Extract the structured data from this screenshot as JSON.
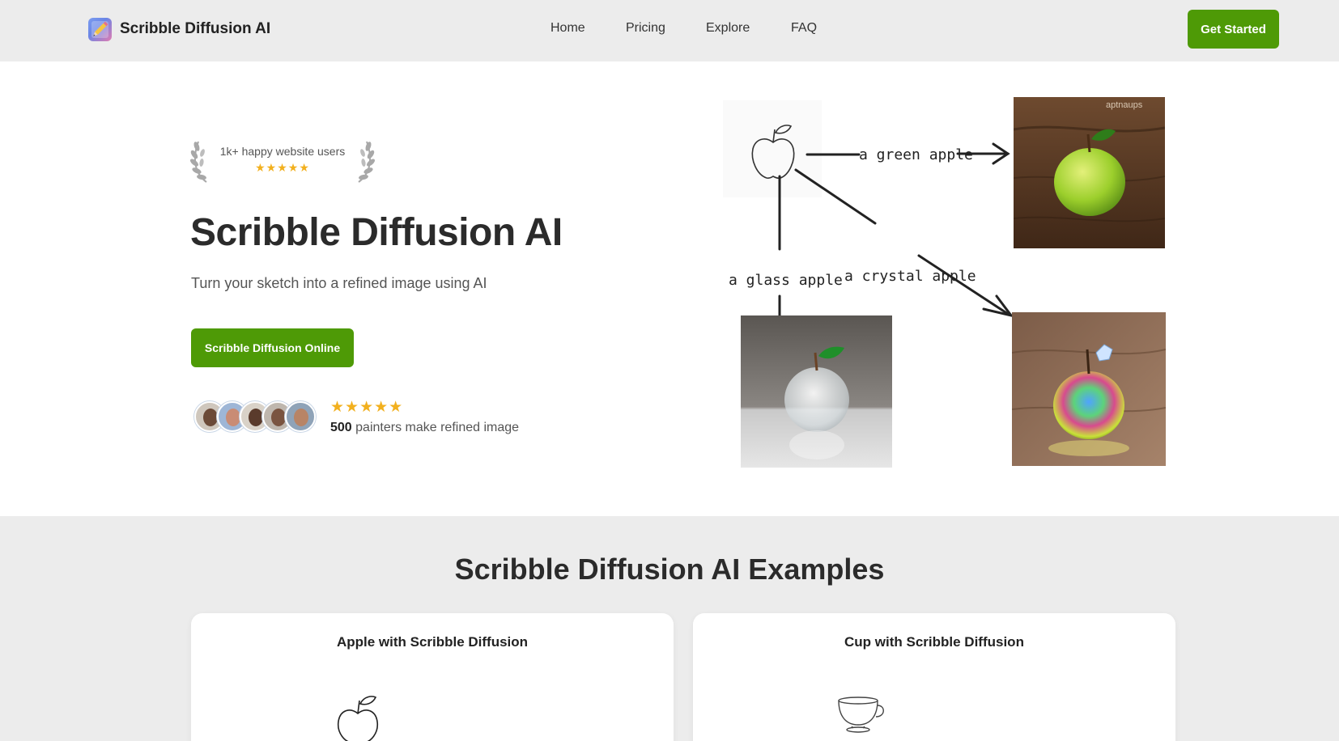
{
  "header": {
    "brand": "Scribble Diffusion AI",
    "nav": [
      "Home",
      "Pricing",
      "Explore",
      "FAQ"
    ],
    "cta": "Get Started",
    "logo_icon": "pencil-icon"
  },
  "hero": {
    "badge_text": "1k+ happy website users",
    "badge_stars": "★★★★★",
    "title": "Scribble Diffusion AI",
    "subtitle": "Turn your sketch into a refined image using AI",
    "cta": "Scribble Diffusion Online",
    "proof_stars": "★★★★★",
    "proof_count": "500",
    "proof_text": " painters make refined image",
    "diagram_labels": [
      "a green apple",
      "a glass apple",
      "a crystal apple"
    ],
    "photo_watermark": "aptnaups"
  },
  "examples": {
    "title": "Scribble Diffusion AI Examples",
    "cards": [
      {
        "title": "Apple with Scribble Diffusion"
      },
      {
        "title": "Cup with Scribble Diffusion"
      }
    ]
  },
  "colors": {
    "accent_green": "#4e9a06",
    "star_gold": "#f2b01e",
    "section_gray": "#ececec"
  }
}
